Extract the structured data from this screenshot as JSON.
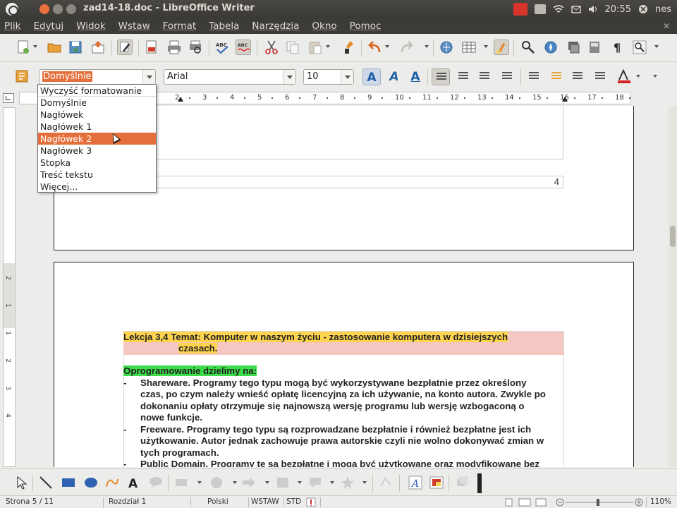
{
  "window": {
    "title": "zad14-18.doc - LibreOffice Writer",
    "clock": "20:55",
    "user": "nes"
  },
  "menu": [
    "Plik",
    "Edytuj",
    "Widok",
    "Wstaw",
    "Format",
    "Tabela",
    "Narzędzia",
    "Okno",
    "Pomoc"
  ],
  "formatting": {
    "style_value": "Domyślnie",
    "font_value": "Arial",
    "size_value": "10"
  },
  "style_dropdown": {
    "options": [
      "Wyczyść formatowanie",
      "Domyślnie",
      "Nagłówek",
      "Nagłówek 1",
      "Nagłówek 2",
      "Nagłówek 3",
      "Stopka",
      "Treść tekstu",
      "Więcej..."
    ],
    "highlighted": "Nagłówek 2"
  },
  "ruler": {
    "ticks": [
      "2",
      "3",
      "4",
      "5",
      "6",
      "7",
      "8",
      "9",
      "10",
      "11",
      "12",
      "13",
      "14",
      "15",
      "16",
      "17",
      "18"
    ],
    "vticks": [
      "2",
      "1",
      "1",
      "2",
      "3",
      "4"
    ]
  },
  "document": {
    "page_number": "4",
    "heading_line1": "Lekcja 3,4  Temat: Komputer w naszym życiu - zastosowanie komputera w dzisiejszych",
    "heading_line2": "czasach.",
    "subheading": "Oprogramowanie dzielimy na:",
    "items": [
      {
        "dash": "-",
        "lines": [
          "Shareware. Programy tego typu mogą być wykorzystywane bezpłatnie przez określony",
          "czas, po czym należy wnieść opłatę licencyjną za ich używanie, na konto autora. Zwykle po",
          "dokonaniu opłaty otrzymuje się najnowszą wersję programu lub wersję wzbogaconą o",
          "nowe funkcje."
        ]
      },
      {
        "dash": "-",
        "lines": [
          "Freeware. Programy tego typu są rozprowadzane bezpłatnie i również bezpłatne jest ich",
          "użytkowanie. Autor jednak zachowuje prawa autorskie czyli nie wolno dokonywać zmian w",
          "tych programach."
        ]
      },
      {
        "dash": "-",
        "lines": [
          "Public Domain. Programy te są bezpłatne i mogą być użytkowane oraz modyfikowane bez"
        ]
      }
    ]
  },
  "status": {
    "page": "Strona  5 / 11",
    "section": "Rozdział 1",
    "language": "Polski",
    "insert_mode": "WSTAW",
    "selection_mode": "STD",
    "zoom": "110%"
  },
  "colors": {
    "accent": "#e46f3b",
    "heading_highlight": "#fed44e",
    "heading_shading": "#f4c7c3",
    "subheading_highlight": "#3ddc4a"
  }
}
